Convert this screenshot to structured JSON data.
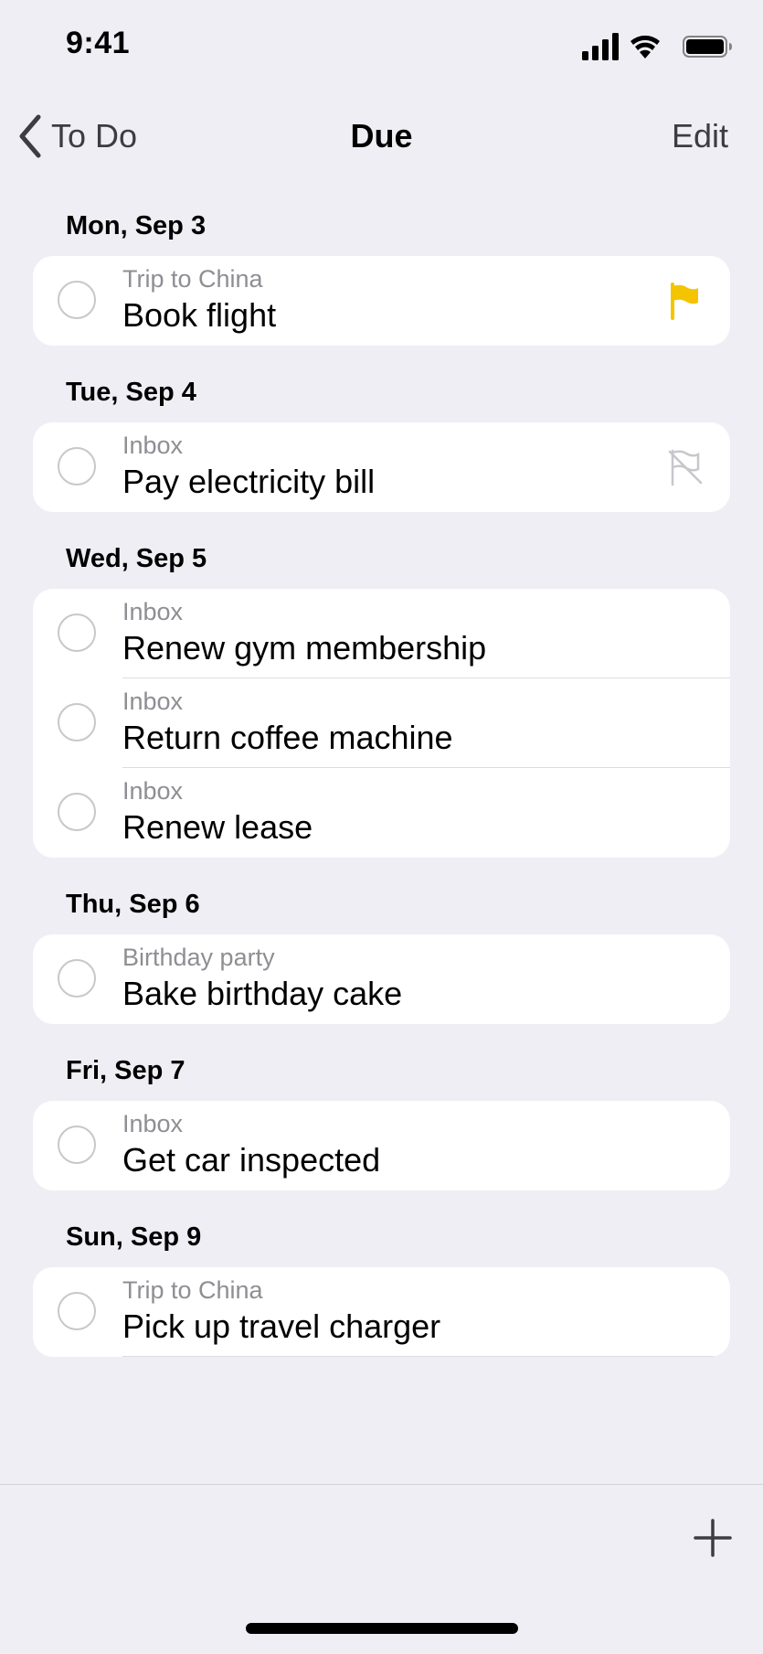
{
  "status": {
    "time": "9:41"
  },
  "nav": {
    "back_label": "To Do",
    "title": "Due",
    "edit_label": "Edit"
  },
  "colors": {
    "flag_active": "#f5c400",
    "flag_inactive": "#c7c7cc",
    "background": "#efeef4"
  },
  "sections": [
    {
      "date": "Mon, Sep 3",
      "items": [
        {
          "list": "Trip to China",
          "title": "Book flight",
          "flag": "flag-filled-icon"
        }
      ]
    },
    {
      "date": "Tue, Sep 4",
      "items": [
        {
          "list": "Inbox",
          "title": "Pay electricity bill",
          "flag": "flag-off-icon"
        }
      ]
    },
    {
      "date": "Wed, Sep 5",
      "items": [
        {
          "list": "Inbox",
          "title": "Renew gym membership"
        },
        {
          "list": "Inbox",
          "title": "Return coffee machine"
        },
        {
          "list": "Inbox",
          "title": "Renew lease"
        }
      ]
    },
    {
      "date": "Thu, Sep 6",
      "items": [
        {
          "list": "Birthday party",
          "title": "Bake birthday cake"
        }
      ]
    },
    {
      "date": "Fri, Sep 7",
      "items": [
        {
          "list": "Inbox",
          "title": "Get car inspected"
        }
      ]
    },
    {
      "date": "Sun, Sep 9",
      "items": [
        {
          "list": "Trip to China",
          "title": "Pick up travel charger"
        }
      ]
    }
  ],
  "toolbar": {
    "add_icon": "plus-icon"
  }
}
